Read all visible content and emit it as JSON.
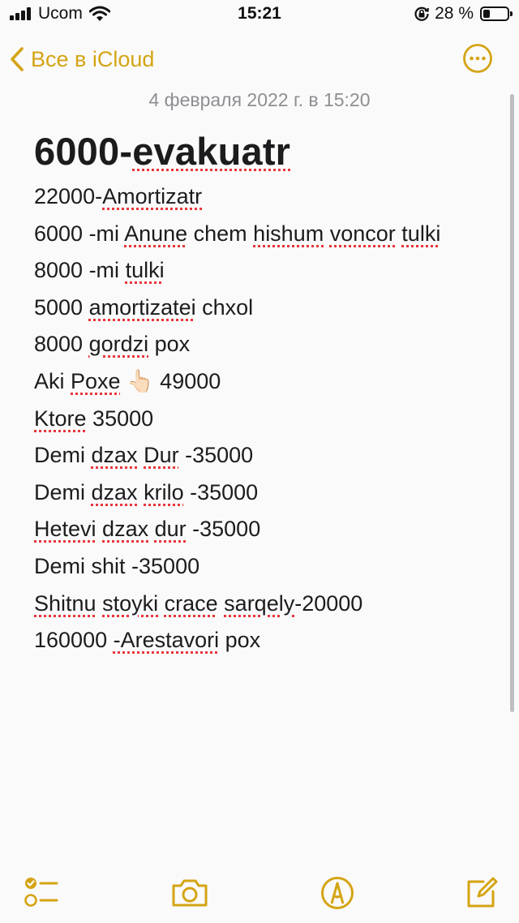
{
  "status_bar": {
    "carrier": "Ucom",
    "time": "15:21",
    "battery_percent": "28 %",
    "battery_level": 0.28,
    "icons": [
      "signal-bars-icon",
      "wifi-icon",
      "orientation-lock-icon",
      "battery-icon"
    ]
  },
  "nav": {
    "back_label": "Все в iCloud",
    "back_icon": "chevron-left-icon",
    "more_icon": "ellipsis-circle-icon"
  },
  "note": {
    "date": "4 февраля 2022 г. в 15:20",
    "title": {
      "segments": [
        {
          "text": "6000-",
          "misspelled": false
        },
        {
          "text": "evakuatr",
          "misspelled": true
        }
      ]
    },
    "lines": [
      {
        "segments": [
          {
            "text": "22000-",
            "misspelled": false
          },
          {
            "text": "Amortizatr",
            "misspelled": true
          }
        ]
      },
      {
        "segments": [
          {
            "text": "6000 -mi ",
            "misspelled": false
          },
          {
            "text": "Anune",
            "misspelled": true
          },
          {
            "text": " chem ",
            "misspelled": false
          },
          {
            "text": "hishum",
            "misspelled": true
          },
          {
            "text": " ",
            "misspelled": false
          },
          {
            "text": "voncor",
            "misspelled": true
          },
          {
            "text": " ",
            "misspelled": false
          },
          {
            "text": "tulki",
            "misspelled": true
          }
        ]
      },
      {
        "segments": [
          {
            "text": "8000 -mi ",
            "misspelled": false
          },
          {
            "text": "tulki",
            "misspelled": true
          }
        ]
      },
      {
        "segments": [
          {
            "text": "5000 ",
            "misspelled": false
          },
          {
            "text": "amortizatei",
            "misspelled": true
          },
          {
            "text": " chxol",
            "misspelled": false
          }
        ]
      },
      {
        "segments": [
          {
            "text": "8000 ",
            "misspelled": false
          },
          {
            "text": "gordzi",
            "misspelled": true
          },
          {
            "text": " pox",
            "misspelled": false
          }
        ]
      },
      {
        "segments": [
          {
            "text": "Aki ",
            "misspelled": false
          },
          {
            "text": "Poxe",
            "misspelled": true
          },
          {
            "text": " 👆🏻 49000",
            "misspelled": false
          }
        ]
      },
      {
        "segments": [
          {
            "text": "Ktore",
            "misspelled": true
          },
          {
            "text": " 35000",
            "misspelled": false
          }
        ]
      },
      {
        "segments": [
          {
            "text": "Demi ",
            "misspelled": false
          },
          {
            "text": "dzax",
            "misspelled": true
          },
          {
            "text": " ",
            "misspelled": false
          },
          {
            "text": "Dur",
            "misspelled": true
          },
          {
            "text": " -35000",
            "misspelled": false
          }
        ]
      },
      {
        "segments": [
          {
            "text": "Demi ",
            "misspelled": false
          },
          {
            "text": "dzax",
            "misspelled": true
          },
          {
            "text": " ",
            "misspelled": false
          },
          {
            "text": "krilo",
            "misspelled": true
          },
          {
            "text": " -35000",
            "misspelled": false
          }
        ]
      },
      {
        "segments": [
          {
            "text": "Hetevi",
            "misspelled": true
          },
          {
            "text": " ",
            "misspelled": false
          },
          {
            "text": "dzax",
            "misspelled": true
          },
          {
            "text": " ",
            "misspelled": false
          },
          {
            "text": "dur",
            "misspelled": true
          },
          {
            "text": " -35000",
            "misspelled": false
          }
        ]
      },
      {
        "segments": [
          {
            "text": "Demi shit -35000",
            "misspelled": false
          }
        ]
      },
      {
        "segments": [
          {
            "text": "Shitnu",
            "misspelled": true
          },
          {
            "text": " ",
            "misspelled": false
          },
          {
            "text": "stoyki",
            "misspelled": true
          },
          {
            "text": " ",
            "misspelled": false
          },
          {
            "text": "crace",
            "misspelled": true
          },
          {
            "text": " ",
            "misspelled": false
          },
          {
            "text": "sarqely",
            "misspelled": true
          },
          {
            "text": "-20000",
            "misspelled": false
          }
        ]
      },
      {
        "segments": [
          {
            "text": "160000 ",
            "misspelled": false
          },
          {
            "text": "-Arestavori",
            "misspelled": true
          },
          {
            "text": " pox",
            "misspelled": false
          }
        ]
      }
    ]
  },
  "toolbar": {
    "items": [
      {
        "id": "checklist",
        "icon": "checklist-icon"
      },
      {
        "id": "camera",
        "icon": "camera-icon"
      },
      {
        "id": "markup",
        "icon": "markup-pen-icon"
      },
      {
        "id": "compose",
        "icon": "compose-icon"
      }
    ]
  },
  "colors": {
    "accent": "#d4a414",
    "text": "#1c1c1e",
    "date": "#8e8e93",
    "spellcheck": "#e8363a",
    "background": "#fbfafa"
  }
}
